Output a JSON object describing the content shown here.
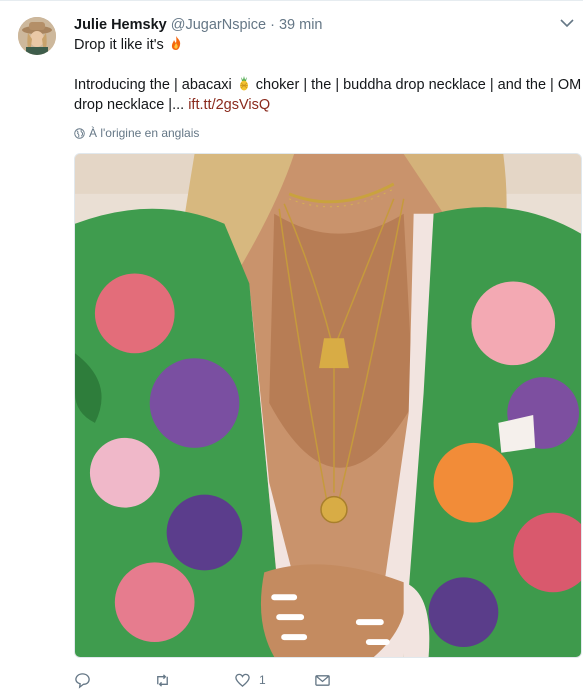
{
  "tweet": {
    "author_name": "Julie Hemsky",
    "handle": "@JugarNspice",
    "separator": "·",
    "time": "39 min",
    "text_line1": "Drop it like it's",
    "text_line2_a": "Introducing the | abacaxi",
    "text_line2_b": "choker | the | buddha drop necklace | and the | OM",
    "text_line3_a": "drop necklace |...",
    "link": "ift.tt/2gsVisQ",
    "translate_label": "À l'origine en anglais",
    "emoji_1": "fire-icon",
    "emoji_2": "pineapple-icon"
  },
  "actions": {
    "reply_icon": "reply-icon",
    "retweet_icon": "retweet-icon",
    "like_icon": "heart-icon",
    "like_count": "1",
    "dm_icon": "envelope-icon"
  },
  "colors": {
    "text": "#14171a",
    "secondary": "#657786",
    "link": "#8a2a1d",
    "border": "#e6ecf0"
  }
}
